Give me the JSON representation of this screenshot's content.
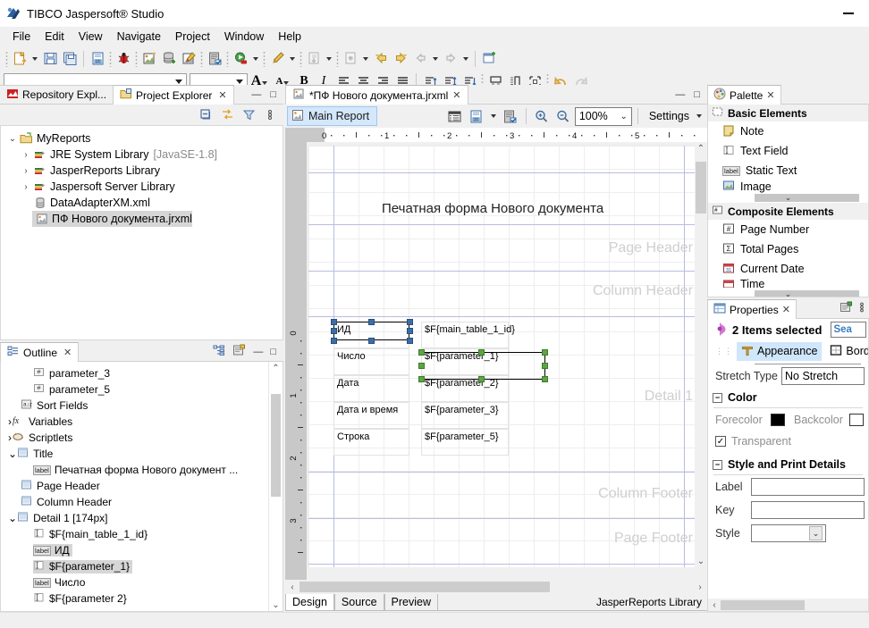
{
  "window": {
    "title": "TIBCO Jaspersoft® Studio",
    "app_icon": "jaspersoft-logo-icon",
    "minimize_label": "—"
  },
  "menu": {
    "items": [
      "File",
      "Edit",
      "View",
      "Navigate",
      "Project",
      "Window",
      "Help"
    ]
  },
  "toolbar1": {
    "buttons": [
      {
        "name": "new-icon",
        "glyph": "new"
      },
      {
        "name": "new-dropdown-icon",
        "glyph": "caret"
      },
      {
        "name": "save-icon",
        "glyph": "save"
      },
      {
        "name": "save-all-icon",
        "glyph": "saveall"
      },
      {
        "name": "new-jrxml-icon",
        "glyph": "jrxml"
      },
      {
        "name": "debug-icon",
        "glyph": "bug"
      },
      {
        "name": "new-report-icon",
        "glyph": "report"
      },
      {
        "name": "new-dataadapter-icon",
        "glyph": "dataadapter"
      },
      {
        "name": "new-style-icon",
        "glyph": "style"
      },
      {
        "name": "compile-report-icon",
        "glyph": "compile"
      },
      {
        "name": "run-icon",
        "glyph": "run"
      },
      {
        "name": "run-dropdown-icon",
        "glyph": "caret"
      },
      {
        "name": "preview-icon",
        "glyph": "brush"
      },
      {
        "name": "preview-dropdown-icon",
        "glyph": "caret"
      },
      {
        "name": "import-icon",
        "glyph": "import"
      },
      {
        "name": "import-dropdown-icon",
        "glyph": "caret"
      },
      {
        "name": "export-icon",
        "glyph": "export"
      },
      {
        "name": "export-dropdown-icon",
        "glyph": "caret"
      },
      {
        "name": "back-yellow-icon",
        "glyph": "backyellow"
      },
      {
        "name": "forward-yellow-icon",
        "glyph": "fwdyellow"
      },
      {
        "name": "back-nav-icon",
        "glyph": "backgrey"
      },
      {
        "name": "back-nav-dropdown-icon",
        "glyph": "caret"
      },
      {
        "name": "forward-nav-icon",
        "glyph": "fwdgrey"
      },
      {
        "name": "forward-nav-dropdown-icon",
        "glyph": "caret"
      },
      {
        "name": "new-window-icon",
        "glyph": "newwin"
      }
    ]
  },
  "toolbar2": {
    "font_family_value": "",
    "font_size_value": "",
    "increase_font_label": "A",
    "decrease_font_label": "A",
    "bold_label": "B",
    "italic_label": "I",
    "buttons": [
      {
        "name": "align-left-icon"
      },
      {
        "name": "align-center-icon"
      },
      {
        "name": "align-right-icon"
      },
      {
        "name": "align-justify-icon"
      },
      {
        "name": "align-top-icon"
      },
      {
        "name": "align-middle-icon"
      },
      {
        "name": "align-bottom-icon"
      },
      {
        "name": "size-to-fit-icon"
      },
      {
        "name": "distribute-icon"
      },
      {
        "name": "group-icon"
      },
      {
        "name": "undo-icon"
      },
      {
        "name": "redo-icon"
      }
    ]
  },
  "left_top_panel": {
    "tabs": [
      {
        "label": "Repository Expl...",
        "icon": "repository-icon",
        "active": false
      },
      {
        "label": "Project Explorer",
        "icon": "project-explorer-icon",
        "active": true
      }
    ],
    "close_glyph": "✕",
    "toolbar_icons": [
      "collapse-all-icon",
      "link-with-editor-icon",
      "filter-icon",
      "view-menu-icon"
    ],
    "minimize_glyph": "—",
    "maximize_glyph": "□",
    "tree": [
      {
        "label": "MyReports",
        "icon": "project-folder-icon",
        "depth": 0,
        "arrow": "down",
        "selected": false
      },
      {
        "label": "JRE System Library",
        "suffix": "[JavaSE-1.8]",
        "icon": "library-icon",
        "depth": 1,
        "arrow": "right",
        "selected": false
      },
      {
        "label": "JasperReports Library",
        "suffix": "",
        "icon": "library-icon",
        "depth": 1,
        "arrow": "right",
        "selected": false
      },
      {
        "label": "Jaspersoft Server Library",
        "suffix": "",
        "icon": "library-icon",
        "depth": 1,
        "arrow": "right",
        "selected": false
      },
      {
        "label": "DataAdapterXM.xml",
        "suffix": "",
        "icon": "dataadapter-file-icon",
        "depth": 1,
        "arrow": "none",
        "selected": false
      },
      {
        "label": "ПФ Нового документа.jrxml",
        "suffix": "",
        "icon": "jrxml-file-icon",
        "depth": 1,
        "arrow": "none",
        "selected": true
      }
    ]
  },
  "outline_panel": {
    "tab_label": "Outline",
    "tab_icon": "outline-icon",
    "close_glyph": "✕",
    "toolbar_icons": [
      "tree-view-icon",
      "properties-view-icon"
    ],
    "minimize_glyph": "—",
    "maximize_glyph": "□",
    "items": [
      {
        "label": "parameter_3",
        "icon": "parameter-icon",
        "depth": 2,
        "arrow": "none",
        "selected": false
      },
      {
        "label": "parameter_5",
        "icon": "parameter-icon",
        "depth": 2,
        "arrow": "none",
        "selected": false
      },
      {
        "label": "Sort Fields",
        "icon": "sort-fields-icon",
        "depth": 1,
        "arrow": "none",
        "selected": false
      },
      {
        "label": "Variables",
        "icon": "variables-icon",
        "depth": 1,
        "arrow": "right",
        "selected": false
      },
      {
        "label": "Scriptlets",
        "icon": "scriptlets-icon",
        "depth": 1,
        "arrow": "right",
        "selected": false
      },
      {
        "label": "Title",
        "icon": "band-icon",
        "depth": 1,
        "arrow": "down",
        "selected": false
      },
      {
        "label": "Печатная форма Нового документ ...",
        "icon": "label-icon",
        "depth": 2,
        "arrow": "none",
        "selected": false
      },
      {
        "label": "Page Header",
        "icon": "band-icon",
        "depth": 1,
        "arrow": "none",
        "selected": false
      },
      {
        "label": "Column Header",
        "icon": "band-icon",
        "depth": 1,
        "arrow": "none",
        "selected": false
      },
      {
        "label": "Detail 1 [174px]",
        "icon": "band-icon",
        "depth": 1,
        "arrow": "down",
        "selected": false
      },
      {
        "label": "$F{main_table_1_id}",
        "icon": "textfield-icon",
        "depth": 2,
        "arrow": "none",
        "selected": false
      },
      {
        "label": "ИД",
        "icon": "label-icon",
        "depth": 2,
        "arrow": "none",
        "selected": true
      },
      {
        "label": "$F{parameter_1}",
        "icon": "textfield-icon",
        "depth": 2,
        "arrow": "none",
        "selected": true
      },
      {
        "label": "Число",
        "icon": "label-icon",
        "depth": 2,
        "arrow": "none",
        "selected": false
      },
      {
        "label": "$F{parameter 2}",
        "icon": "textfield-icon",
        "depth": 2,
        "arrow": "none",
        "selected": false
      }
    ]
  },
  "editor": {
    "tab": {
      "label": "*ПФ Нового документа.jrxml",
      "icon": "jrxml-file-icon",
      "close_glyph": "✕"
    },
    "minimize_glyph": "—",
    "maximize_glyph": "□",
    "main_report_label": "Main Report",
    "main_report_icon": "report-icon",
    "toolbar_icons": [
      "bands-icon",
      "dataset-icon",
      "dataset-dropdown-icon",
      "compile-icon"
    ],
    "zoom_in_icon": "zoom-in-icon",
    "zoom_out_icon": "zoom-out-icon",
    "zoom_value": "100%",
    "settings_label": "Settings",
    "ruler_h_labels": [
      "0",
      "1",
      "2",
      "3",
      "4",
      "5"
    ],
    "ruler_v_labels": [
      "0",
      "1",
      "2",
      "3"
    ],
    "bands": [
      {
        "label": "Page Header"
      },
      {
        "label": "Column Header"
      },
      {
        "label": "Detail 1"
      },
      {
        "label": "Column Footer"
      },
      {
        "label": "Page Footer"
      }
    ],
    "title_text": "Печатная форма Нового документа",
    "detail_rows": [
      {
        "label": "ИД",
        "field": "$F{main_table_1_id}"
      },
      {
        "label": "Число",
        "field": "$F{parameter_1}"
      },
      {
        "label": "Дата",
        "field": "$F{parameter_2}"
      },
      {
        "label": "Дата и время",
        "field": "$F{parameter_3}"
      },
      {
        "label": "Строка",
        "field": "$F{parameter_5}"
      }
    ],
    "bottom_tabs": [
      {
        "label": "Design",
        "active": true
      },
      {
        "label": "Source",
        "active": false
      },
      {
        "label": "Preview",
        "active": false
      }
    ],
    "status_right": "JasperReports Library"
  },
  "palette": {
    "tab_label": "Palette",
    "tab_icon": "palette-icon",
    "close_glyph": "✕",
    "groups": [
      {
        "title": "Basic Elements",
        "icon": "basic-elements-icon",
        "items": [
          {
            "label": "Note",
            "icon": "note-icon"
          },
          {
            "label": "Text Field",
            "icon": "textfield-icon"
          },
          {
            "label": "Static Text",
            "icon": "label-icon"
          },
          {
            "label": "Image",
            "icon": "image-icon"
          }
        ]
      },
      {
        "title": "Composite Elements",
        "icon": "composite-elements-icon",
        "items": [
          {
            "label": "Page Number",
            "icon": "page-number-icon"
          },
          {
            "label": "Total Pages",
            "icon": "total-pages-icon"
          },
          {
            "label": "Current Date",
            "icon": "current-date-icon"
          },
          {
            "label": "Time",
            "icon": "time-icon"
          }
        ]
      }
    ]
  },
  "properties": {
    "tab_label": "Properties",
    "tab_icon": "properties-icon",
    "close_glyph": "✕",
    "toolbar_icons": [
      "pin-properties-icon",
      "view-menu-icon"
    ],
    "minimize_glyph": "—",
    "selection_title": "2 Items selected",
    "selection_icon": "selection-icon",
    "search_placeholder": "Sea",
    "tabs": [
      {
        "label": "Appearance",
        "icon": "appearance-icon",
        "active": true
      },
      {
        "label": "Borders",
        "icon": "borders-icon",
        "active": false
      }
    ],
    "stretch_type_label": "Stretch Type",
    "stretch_type_value": "No Stretch",
    "color_section": "Color",
    "forecolor_label": "Forecolor",
    "forecolor_value": "#000000",
    "backcolor_label": "Backcolor",
    "backcolor_value": "#ffffff",
    "transparent_label": "Transparent",
    "transparent_checked": true,
    "style_section": "Style and Print Details",
    "label_label": "Label",
    "label_value": "",
    "key_label": "Key",
    "key_value": "",
    "style_label": "Style",
    "style_value": ""
  }
}
